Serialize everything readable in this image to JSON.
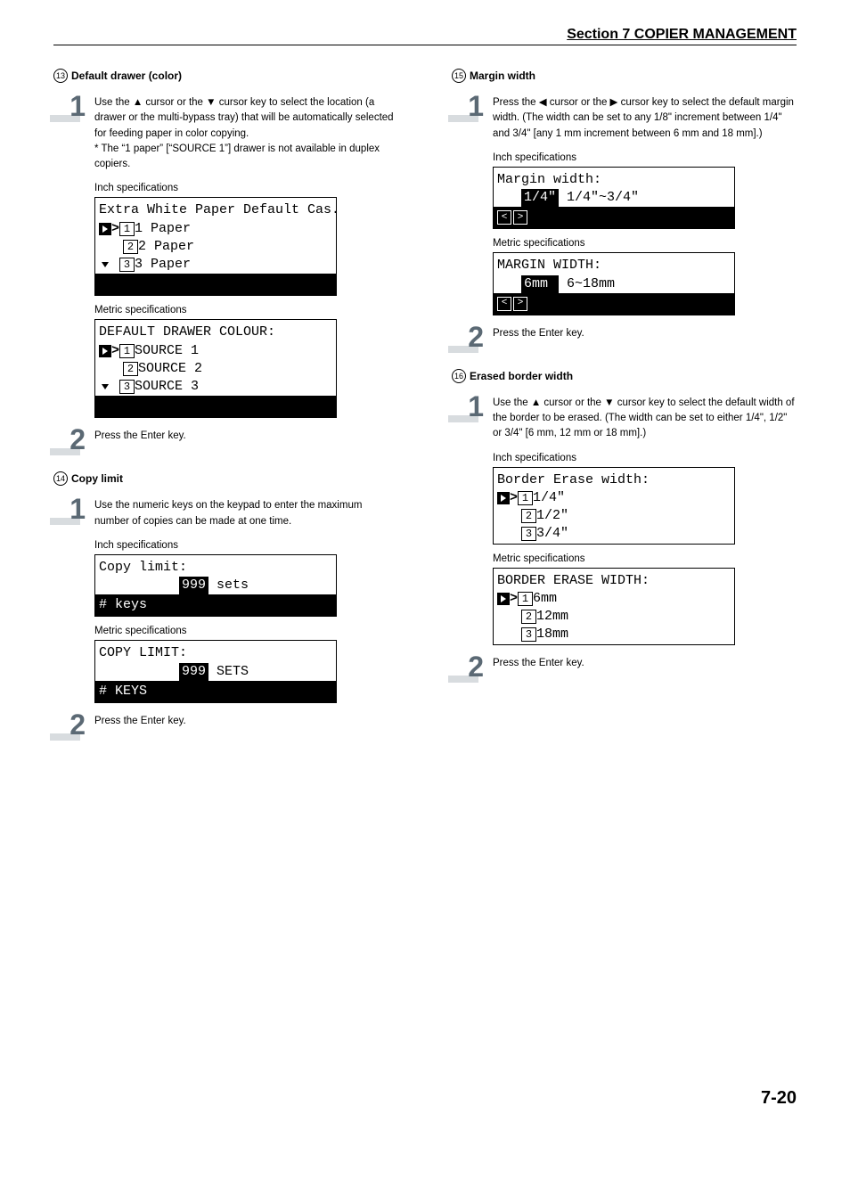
{
  "header": "Section 7  COPIER MANAGEMENT",
  "left": {
    "h13": {
      "num": "13",
      "title": "Default drawer (color)"
    },
    "s13_1": {
      "num": "1",
      "text": "Use the ▲ cursor or the ▼ cursor key to select the location (a drawer or the multi-bypass tray) that will be automatically selected for feeding paper in color copying.",
      "note": "* The “1 paper” [“SOURCE 1”] drawer is not available in duplex copiers."
    },
    "specInch": "Inch specifications",
    "lcd13a": {
      "title": "Extra White Paper Default Cas.",
      "r1": "1 Paper",
      "r2": "2 Paper",
      "r3": "3 Paper"
    },
    "specMetric": "Metric specifications",
    "lcd13b": {
      "title": "DEFAULT DRAWER COLOUR:",
      "r1": "SOURCE 1",
      "r2": "SOURCE 2",
      "r3": "SOURCE 3"
    },
    "s13_2": {
      "num": "2",
      "text": "Press the Enter key."
    },
    "h14": {
      "num": "14",
      "title": "Copy limit"
    },
    "s14_1": {
      "num": "1",
      "text": "Use the numeric keys on the keypad to enter the maximum number of copies can be made at one time."
    },
    "lcd14a": {
      "title": "Copy limit:",
      "val": "999",
      "unit": " sets",
      "footer": "# keys"
    },
    "lcd14b": {
      "title": "COPY LIMIT:",
      "val": "999",
      "unit": " SETS",
      "footer": "# KEYS"
    },
    "s14_2": {
      "num": "2",
      "text": "Press the Enter key."
    }
  },
  "right": {
    "h15": {
      "num": "15",
      "title": "Margin width"
    },
    "s15_1": {
      "num": "1",
      "text": "Press the ◀ cursor or the ▶ cursor key to select the default margin width. (The width can be set to any 1/8\" increment between 1/4\" and 3/4\" [any 1 mm increment between 6 mm and 18 mm].)"
    },
    "specInch": "Inch specifications",
    "lcd15a": {
      "title": "Margin width:",
      "val": "1/4\"",
      "range": " 1/4\"~3/4\""
    },
    "specMetric": "Metric specifications",
    "lcd15b": {
      "title": "MARGIN WIDTH:",
      "val": "6mm ",
      "range": " 6~18mm"
    },
    "s15_2": {
      "num": "2",
      "text": "Press the Enter key."
    },
    "h16": {
      "num": "16",
      "title": "Erased border width"
    },
    "s16_1": {
      "num": "1",
      "text": "Use the ▲ cursor or the ▼ cursor key to select the default width of the border to be erased. (The width can be set to either 1/4\", 1/2\" or 3/4\" [6 mm, 12 mm or 18 mm].)"
    },
    "lcd16a": {
      "title": "Border Erase width:",
      "r1": "1/4\"",
      "r2": "1/2\"",
      "r3": "3/4\""
    },
    "lcd16b": {
      "title": "BORDER ERASE WIDTH:",
      "r1": "6mm",
      "r2": "12mm",
      "r3": "18mm"
    },
    "s16_2": {
      "num": "2",
      "text": "Press the Enter key."
    }
  },
  "pageNum": "7-20"
}
